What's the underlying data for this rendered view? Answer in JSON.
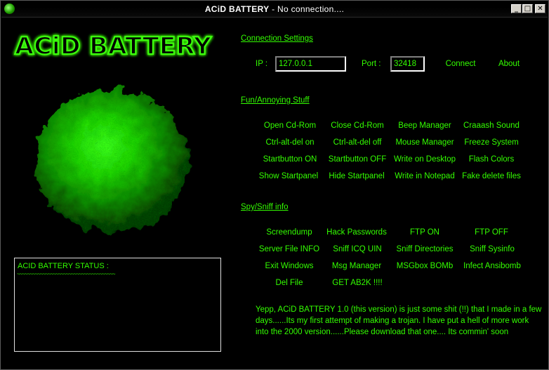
{
  "window": {
    "title_app": "ACiD BATTERY",
    "title_sep": " - ",
    "title_status": "No connection....",
    "min_glyph": "_",
    "max_glyph": "□",
    "close_glyph": "✕"
  },
  "logo": {
    "text": "ACiD BATTERY"
  },
  "connection": {
    "section_label": "Connection Settings",
    "ip_label": "IP :",
    "ip_value": "127.0.0.1",
    "port_label": "Port :",
    "port_value": "32418",
    "connect_label": "Connect",
    "about_label": "About"
  },
  "fun": {
    "section_label": "Fun/Annoying Stuff",
    "rows": [
      [
        "Open Cd-Rom",
        "Close Cd-Rom",
        "Beep Manager",
        "Craaash Sound"
      ],
      [
        "Ctrl-alt-del on",
        "Ctrl-alt-del off",
        "Mouse Manager",
        "Freeze System"
      ],
      [
        "Startbutton ON",
        "Startbutton OFF",
        "Write on Desktop",
        "Flash Colors"
      ],
      [
        "Show Startpanel",
        "Hide Startpanel",
        "Write in Notepad",
        "Fake delete files"
      ]
    ]
  },
  "spy": {
    "section_label": "Spy/Sniff info",
    "rows": [
      [
        "Screendump",
        "Hack Passwords",
        "FTP ON",
        "FTP OFF"
      ],
      [
        "Server File INFO",
        "Sniff ICQ UIN",
        "Sniff Directories",
        "Sniff Sysinfo"
      ],
      [
        "Exit Windows",
        "Msg Manager",
        "MSGbox BOMb",
        "Infect Ansibomb"
      ],
      [
        "Del File",
        "GET AB2K !!!!",
        "",
        ""
      ]
    ]
  },
  "status": {
    "title": "ACID BATTERY STATUS :",
    "wave": "~~~~~~~~~~~~~~~~~~~~~~~~~~~~~~~~~~~~~~"
  },
  "info": {
    "text": "Yepp, ACiD BATTERY 1.0 (this version) is just some shit (!!) that I made in a few days......Its my first attempt of making a trojan. I have put a hell of more work into the 2000 version......Please download that one.... Its commin' soon"
  },
  "colors": {
    "accent": "#33ff00",
    "background": "#000000"
  },
  "icons": [
    "acid-battery-app-icon",
    "minimize-icon",
    "maximize-icon",
    "close-icon"
  ]
}
